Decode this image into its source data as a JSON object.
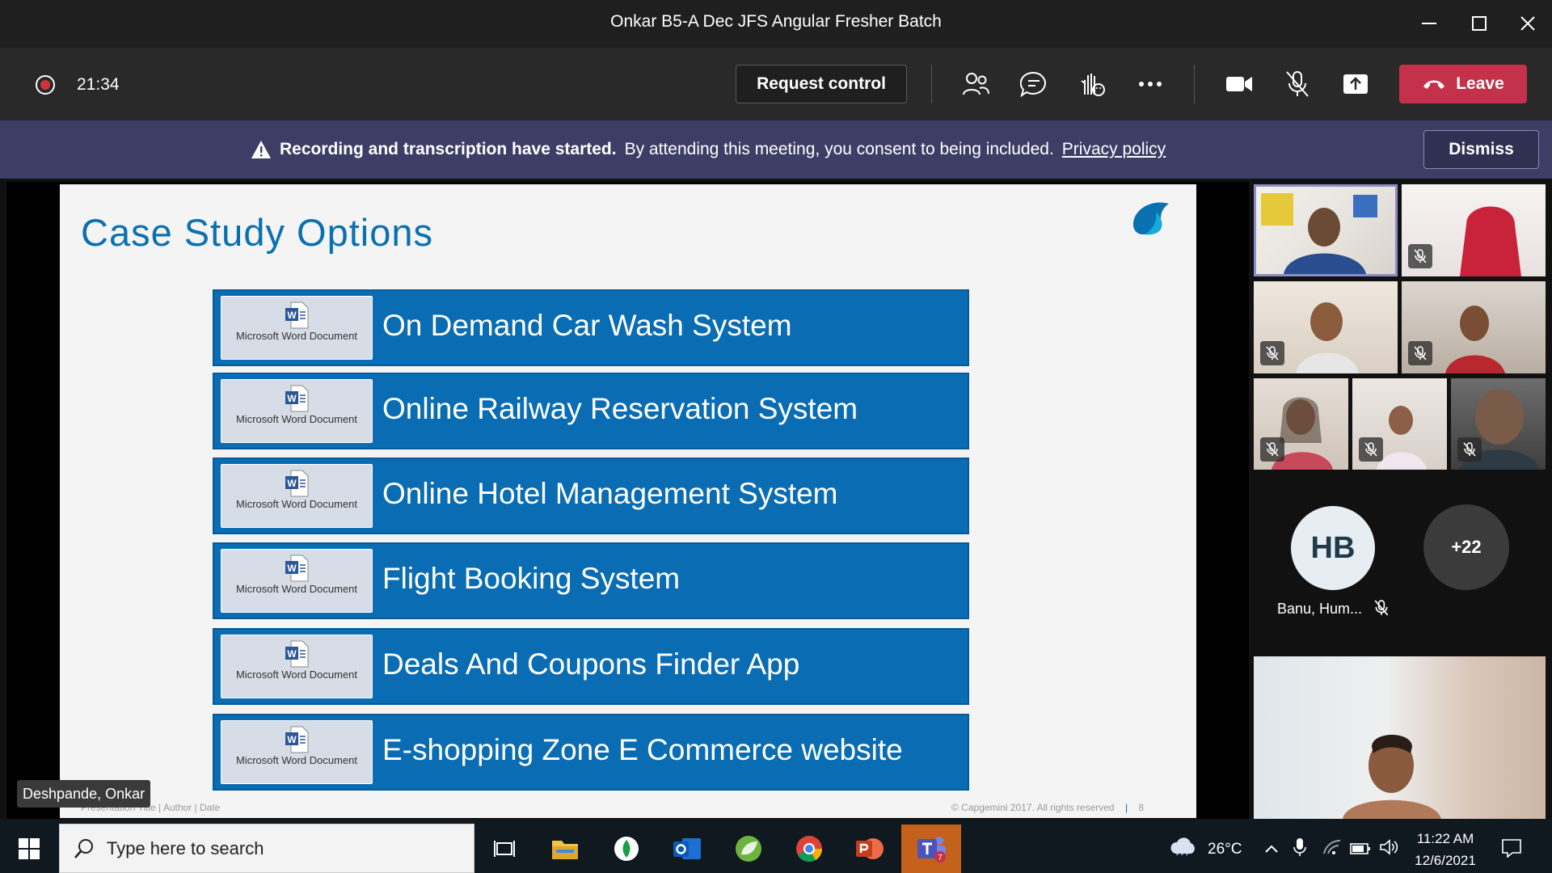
{
  "window": {
    "title": "Onkar B5-A Dec JFS Angular Fresher Batch"
  },
  "toolbar": {
    "timer": "21:34",
    "request_control": "Request control",
    "leave": "Leave"
  },
  "banner": {
    "bold_text": "Recording and transcription have started.",
    "text": "By attending this meeting, you consent to being included.",
    "link": "Privacy policy",
    "dismiss": "Dismiss"
  },
  "slide": {
    "title": "Case Study Options",
    "doc_caption": "Microsoft Word Document",
    "options": [
      {
        "label": "On Demand Car Wash System"
      },
      {
        "label": "Online Railway Reservation System"
      },
      {
        "label": "Online Hotel Management System"
      },
      {
        "label": "Flight Booking System"
      },
      {
        "label": "Deals And Coupons Finder App"
      },
      {
        "label": "E-shopping Zone E Commerce website"
      }
    ],
    "footer_left": "Presentation Title | Author | Date",
    "footer_right": "© Capgemini 2017. All rights reserved",
    "page_number": "8",
    "presenter": "Deshpande, Onkar"
  },
  "participants": {
    "avatar_initials": "HB",
    "avatar_name": "Banu, Hum...",
    "overflow_count": "+22"
  },
  "taskbar": {
    "search_placeholder": "Type here to search",
    "temperature": "26°C",
    "time": "11:22 AM",
    "date": "12/6/2021",
    "teams_badge": "7"
  },
  "colors": {
    "accent_slide_blue": "#0a6db3",
    "leave_red": "#c4314b",
    "banner_bg": "#3d3e66"
  }
}
